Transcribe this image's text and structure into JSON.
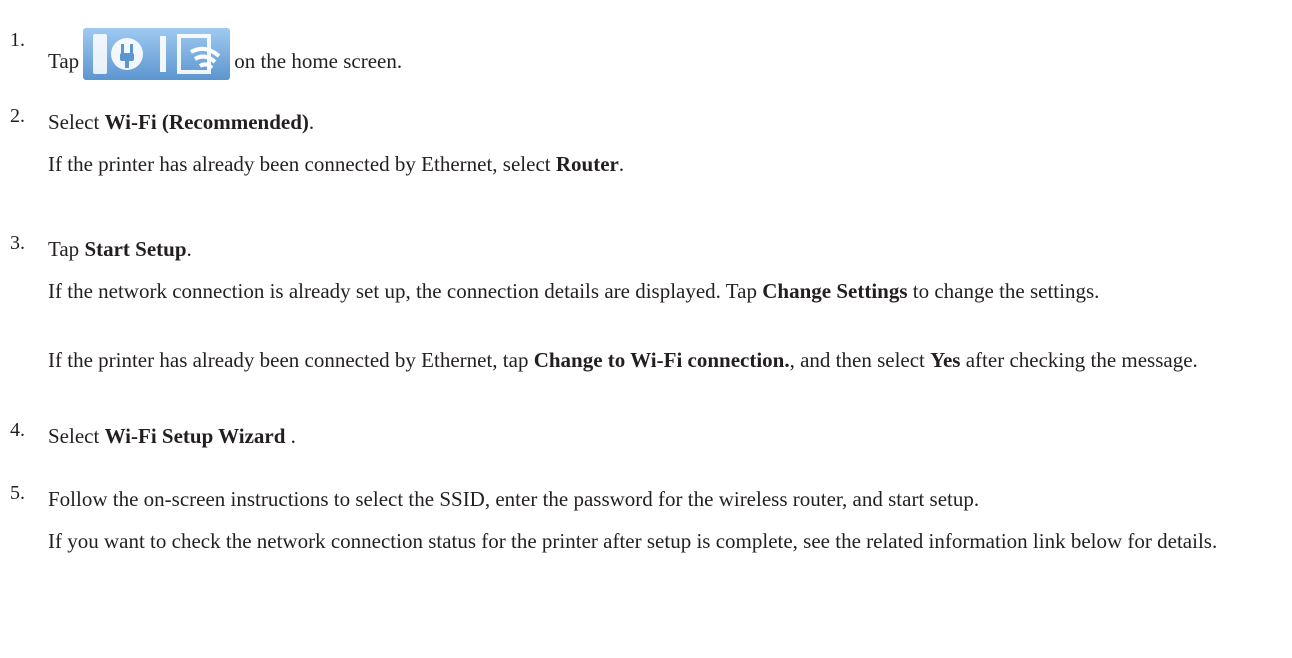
{
  "steps": [
    {
      "number": "1.",
      "main_before": "Tap",
      "icon": "network-status-icon",
      "main_after": "on the home screen."
    },
    {
      "number": "2.",
      "main_before": "Select ",
      "main_bold": "Wi-Fi (Recommended)",
      "main_after": ".",
      "note_before": "If the printer has already been connected by Ethernet, select ",
      "note_bold": "Router",
      "note_after": "."
    },
    {
      "number": "3.",
      "main_before": "Tap ",
      "main_bold": "Start Setup",
      "main_after": ".",
      "note1_before": "If the network connection is already set up, the connection details are displayed. Tap ",
      "note1_bold": "Change Settings",
      "note1_after": " to change the settings.",
      "note2_before": "If the printer has already been connected by Ethernet, tap ",
      "note2_bold1": "Change to Wi-Fi connection.",
      "note2_mid": ", and then select ",
      "note2_bold2": "Yes",
      "note2_after": " after checking the message."
    },
    {
      "number": "4.",
      "main_before": "Select ",
      "main_bold": "Wi-Fi Setup Wizard",
      "main_after": " ."
    },
    {
      "number": "5.",
      "main": "Follow the on-screen instructions to select the SSID, enter the password for the wireless router, and start setup.",
      "note": "If you want to check the network connection status for the printer after setup is complete, see the related information link below for details."
    }
  ]
}
